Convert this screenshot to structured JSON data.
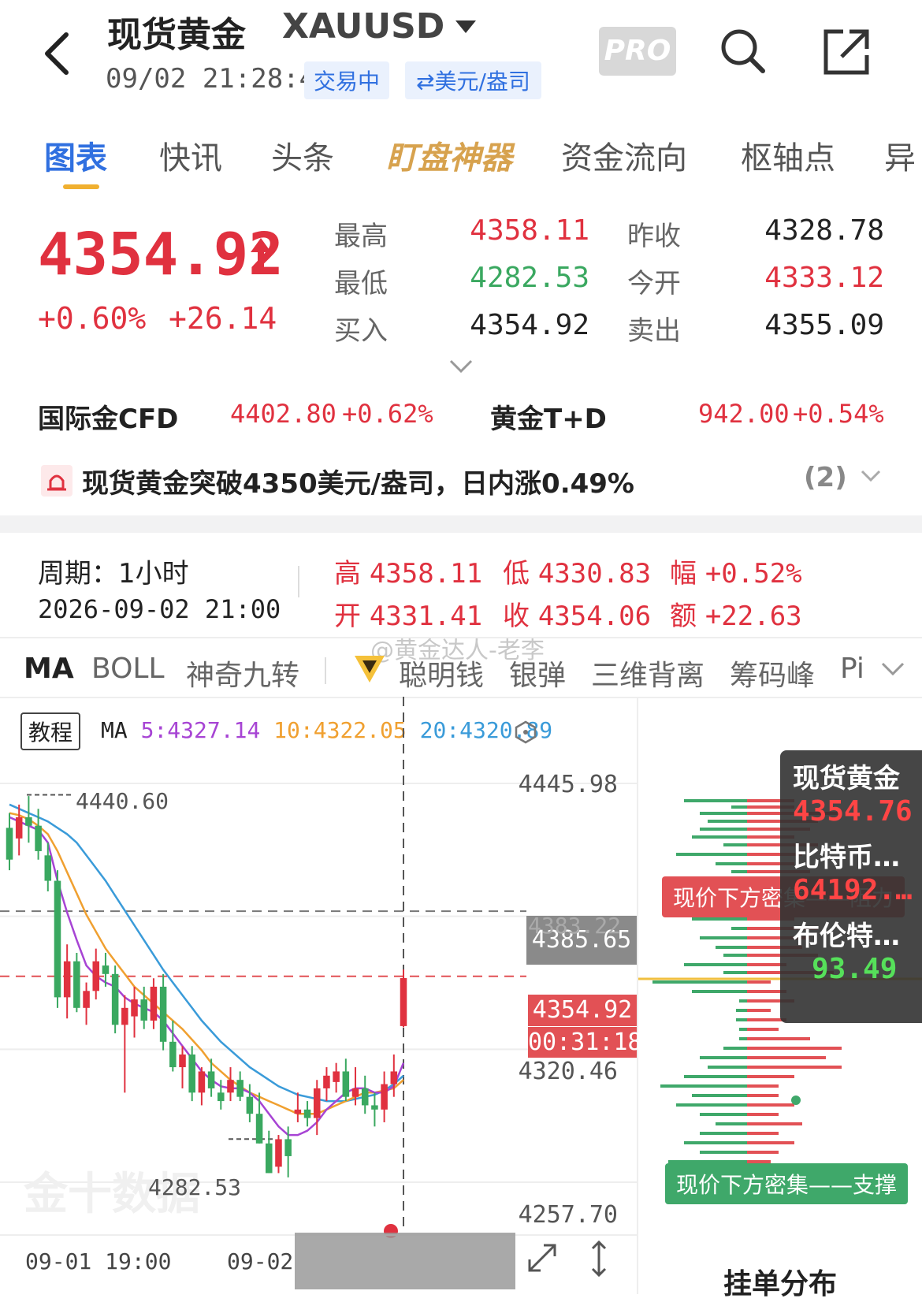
{
  "header": {
    "title": "现货黄金",
    "symbol": "XAUUSD",
    "datetime": "09/02 21:28:41",
    "status_badge": "交易中",
    "unit_badge": "⇄美元/盎司",
    "pro_label": "PRO"
  },
  "tabs": [
    "图表",
    "快讯",
    "头条",
    "盯盘神器",
    "资金流向",
    "枢轴点",
    "异"
  ],
  "active_tab": 0,
  "quote": {
    "price": "4354.92",
    "arrow": "↑",
    "change_pct": "+0.60%",
    "change_abs": "+26.14",
    "labels": {
      "high": "最高",
      "low": "最低",
      "bid": "买入",
      "prev_close": "昨收",
      "open": "今开",
      "ask": "卖出"
    },
    "values": {
      "high": "4358.11",
      "low": "4282.53",
      "bid": "4354.92",
      "prev_close": "4328.78",
      "open": "4333.12",
      "ask": "4355.09"
    }
  },
  "related": {
    "cfd_label": "国际金CFD",
    "cfd_price": "4402.80",
    "cfd_pct": "+0.62%",
    "td_label": "黄金T+D",
    "td_price": "942.00",
    "td_pct": "+0.54%"
  },
  "alert": {
    "text": "现货黄金突破4350美元/盎司，日内涨0.49%",
    "count": "(2)"
  },
  "period": {
    "label": "周期：1小时",
    "time": "2026-09-02 21:00",
    "high_label": "高",
    "high": "4358.11",
    "low_label": "低",
    "low": "4330.83",
    "amp_label": "幅",
    "amp": "+0.52%",
    "open_label": "开",
    "open": "4331.41",
    "close_label": "收",
    "close": "4354.06",
    "chg_label": "额",
    "chg": "+22.63"
  },
  "watermark": "@黄金达人-老李",
  "indicators": [
    "MA",
    "BOLL",
    "神奇九转",
    "聪明钱",
    "银弹",
    "三维背离",
    "筹码峰",
    "Pi"
  ],
  "chart_header": {
    "tutorial": "教程",
    "ma_label": "MA",
    "ma5": "5:4327.14",
    "ma10": "10:4322.05",
    "ma20": "20:4320.89"
  },
  "y_ticks": [
    "4445.98",
    "4385.65",
    "4320.46",
    "4257.70"
  ],
  "tags": {
    "hi_mark": "4440.60",
    "lo_mark": "4282.53",
    "ghost": "4383.22",
    "last_price": "4354.92",
    "countdown": "00:31:18"
  },
  "x_labels": [
    "09-01 19:00",
    "09-02"
  ],
  "overlay": {
    "gold_name": "现货黄金",
    "gold_price": "4354.76",
    "btc_name": "比特币…",
    "btc_price": "64192.…",
    "brent_name": "布伦特…",
    "brent_price": "93.49"
  },
  "depth": {
    "resist_tag": "现价下方密集——阻力",
    "support_tag": "现价下方密集——支撑",
    "title": "挂单分布"
  },
  "logo": "金十数据",
  "colors": {
    "up": "#e0313f",
    "down": "#3aa860",
    "ma5": "#a744d4",
    "ma10": "#f0a030",
    "ma20": "#3a9bd9",
    "accent": "#3070e0"
  },
  "chart_data": {
    "type": "candlestick",
    "ylim": [
      4257.7,
      4445.98
    ],
    "candles": [
      [
        4425,
        4432,
        4405,
        4410
      ],
      [
        4420,
        4436,
        4412,
        4430
      ],
      [
        4430,
        4440,
        4418,
        4426
      ],
      [
        4426,
        4434,
        4410,
        4414
      ],
      [
        4412,
        4418,
        4395,
        4400
      ],
      [
        4400,
        4405,
        4340,
        4345
      ],
      [
        4345,
        4370,
        4335,
        4362
      ],
      [
        4362,
        4366,
        4338,
        4340
      ],
      [
        4340,
        4352,
        4332,
        4348
      ],
      [
        4348,
        4368,
        4344,
        4362
      ],
      [
        4360,
        4366,
        4350,
        4356
      ],
      [
        4356,
        4360,
        4328,
        4332
      ],
      [
        4332,
        4346,
        4300,
        4340
      ],
      [
        4336,
        4350,
        4326,
        4344
      ],
      [
        4344,
        4350,
        4330,
        4334
      ],
      [
        4334,
        4354,
        4330,
        4350
      ],
      [
        4350,
        4356,
        4320,
        4324
      ],
      [
        4324,
        4334,
        4310,
        4312
      ],
      [
        4312,
        4322,
        4302,
        4318
      ],
      [
        4318,
        4322,
        4296,
        4300
      ],
      [
        4300,
        4312,
        4294,
        4310
      ],
      [
        4310,
        4316,
        4298,
        4302
      ],
      [
        4300,
        4306,
        4292,
        4296
      ],
      [
        4300,
        4312,
        4296,
        4306
      ],
      [
        4306,
        4310,
        4296,
        4298
      ],
      [
        4298,
        4304,
        4286,
        4290
      ],
      [
        4290,
        4300,
        4276,
        4276
      ],
      [
        4276,
        4282,
        4262,
        4262
      ],
      [
        4265,
        4280,
        4262,
        4278
      ],
      [
        4278,
        4284,
        4260,
        4270
      ],
      [
        4290,
        4300,
        4286,
        4292
      ],
      [
        4292,
        4296,
        4284,
        4288
      ],
      [
        4288,
        4306,
        4280,
        4302
      ],
      [
        4302,
        4312,
        4296,
        4308
      ],
      [
        4305,
        4314,
        4300,
        4310
      ],
      [
        4310,
        4316,
        4296,
        4298
      ],
      [
        4298,
        4312,
        4294,
        4302
      ],
      [
        4302,
        4308,
        4290,
        4294
      ],
      [
        4294,
        4300,
        4284,
        4292
      ],
      [
        4292,
        4310,
        4286,
        4304
      ],
      [
        4304,
        4318,
        4298,
        4310
      ],
      [
        4331.41,
        4358.11,
        4330.83,
        4354.06
      ]
    ],
    "ma5": [
      4430,
      4428,
      4426,
      4424,
      4418,
      4400,
      4385,
      4372,
      4360,
      4355,
      4352,
      4350,
      4345,
      4342,
      4340,
      4338,
      4334,
      4328,
      4322,
      4316,
      4310,
      4306,
      4303,
      4302,
      4302,
      4300,
      4296,
      4290,
      4284,
      4280,
      4280,
      4282,
      4286,
      4292,
      4296,
      4300,
      4302,
      4302,
      4300,
      4300,
      4303,
      4314
    ],
    "ma10": [
      4432,
      4431,
      4429,
      4426,
      4422,
      4414,
      4404,
      4394,
      4384,
      4376,
      4368,
      4362,
      4356,
      4350,
      4346,
      4342,
      4338,
      4334,
      4330,
      4325,
      4320,
      4314,
      4310,
      4306,
      4303,
      4300,
      4298,
      4296,
      4294,
      4292,
      4290,
      4290,
      4290,
      4292,
      4294,
      4296,
      4298,
      4300,
      4300,
      4301,
      4302,
      4306
    ],
    "ma20": [
      4436,
      4434,
      4432,
      4430,
      4428,
      4425,
      4422,
      4418,
      4412,
      4406,
      4400,
      4393,
      4386,
      4379,
      4372,
      4365,
      4358,
      4352,
      4346,
      4340,
      4334,
      4329,
      4324,
      4320,
      4316,
      4312,
      4309,
      4306,
      4303,
      4301,
      4299,
      4298,
      4297,
      4296,
      4296,
      4296,
      4297,
      4298,
      4299,
      4301,
      4304,
      4308
    ]
  }
}
